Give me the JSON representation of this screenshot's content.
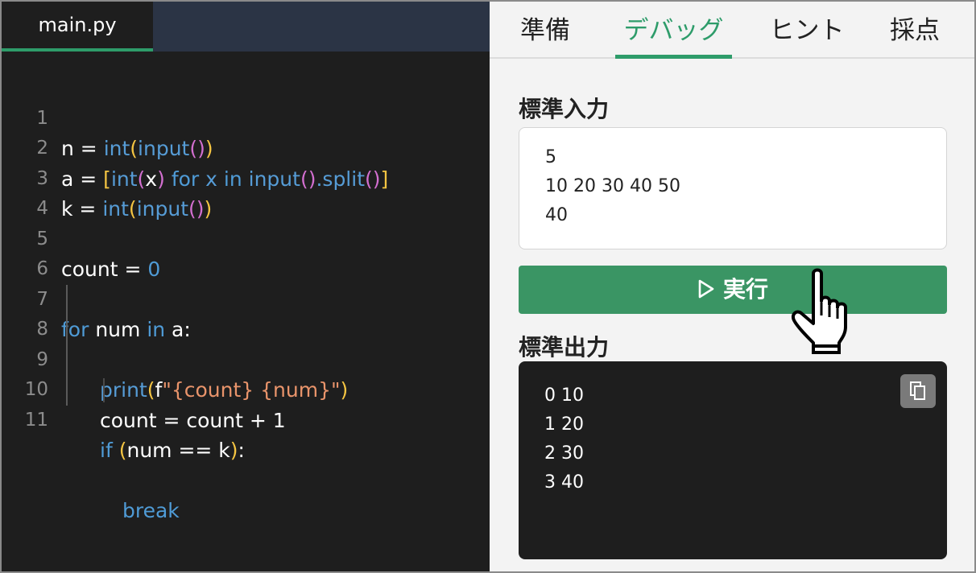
{
  "editor": {
    "file_tab": "main.py",
    "lines": [
      {
        "n": "1"
      },
      {
        "n": "2"
      },
      {
        "n": "3"
      },
      {
        "n": "4"
      },
      {
        "n": "5"
      },
      {
        "n": "6"
      },
      {
        "n": "7"
      },
      {
        "n": "8"
      },
      {
        "n": "9"
      },
      {
        "n": "10"
      },
      {
        "n": "11"
      }
    ]
  },
  "panel": {
    "tabs": [
      "準備",
      "デバッグ",
      "ヒント",
      "採点"
    ],
    "active_tab": "デバッグ",
    "stdin_label": "標準入力",
    "stdin_lines": [
      "5",
      "10 20 30 40 50",
      "40"
    ],
    "run_label": "実行",
    "stdout_label": "標準出力",
    "stdout_lines": [
      "0 10",
      "1 20",
      "2 30",
      "3 40"
    ]
  },
  "colors": {
    "accent": "#2e9c6a",
    "run_button": "#3a9564",
    "editor_bg": "#1e1e1e",
    "tabbar_bg": "#2b3445"
  },
  "icons": [
    "play-icon",
    "copy-icon",
    "pointer-hand-icon"
  ]
}
